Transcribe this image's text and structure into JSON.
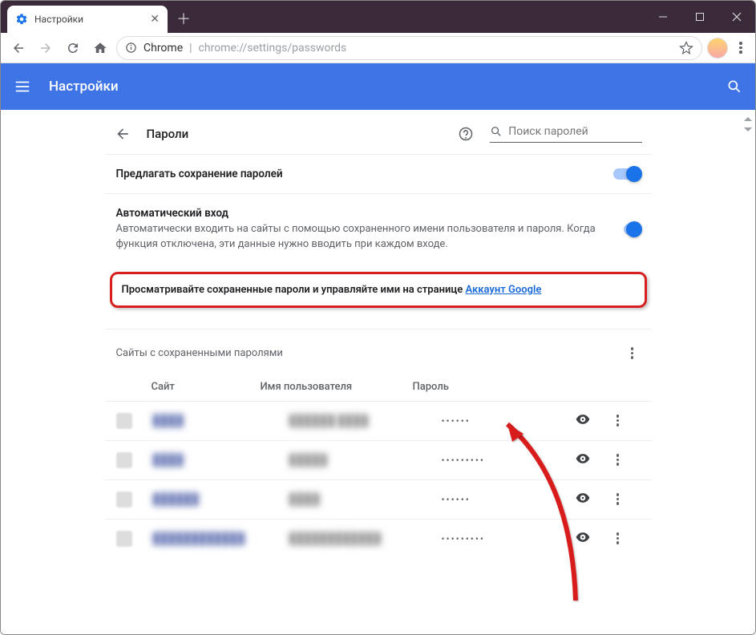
{
  "browser": {
    "tab_title": "Настройки",
    "url_scheme": "Chrome",
    "url_path": "chrome://settings/passwords"
  },
  "header": {
    "title": "Настройки"
  },
  "page": {
    "title": "Пароли",
    "search_placeholder": "Поиск паролей"
  },
  "settings": {
    "offer_save": {
      "label": "Предлагать сохранение паролей"
    },
    "auto_signin": {
      "label": "Автоматический вход",
      "description": "Автоматически входить на сайты с помощью сохраненного имени пользователя и пароля. Когда функция отключена, эти данные нужно вводить при каждом входе."
    },
    "manage_link": {
      "text": "Просматривайте сохраненные пароли и управляйте ими на странице ",
      "link_label": "Аккаунт Google"
    }
  },
  "list": {
    "title": "Сайты с сохраненными паролями",
    "columns": {
      "site": "Сайт",
      "username": "Имя пользователя",
      "password": "Пароль"
    },
    "rows": [
      {
        "site": "████",
        "user": "██████ ████",
        "dots": "••••••"
      },
      {
        "site": "████",
        "user": "█████",
        "dots": "•••••••••"
      },
      {
        "site": "██████",
        "user": "████",
        "dots": "••••••"
      },
      {
        "site": "████████████",
        "user": "████████████",
        "dots": "•••••••••"
      }
    ]
  }
}
